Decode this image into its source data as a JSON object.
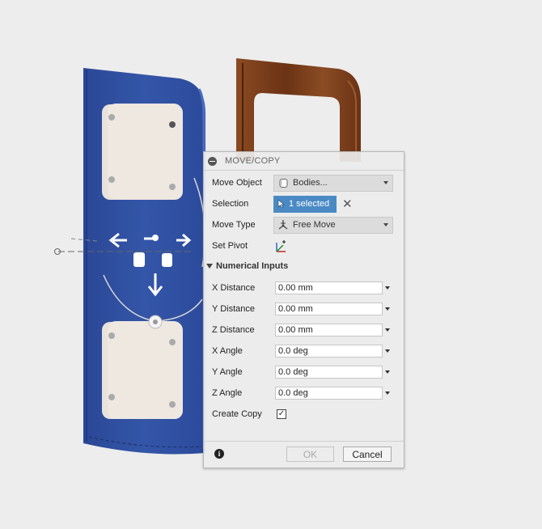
{
  "panel": {
    "title": "MOVE/COPY",
    "move_object": {
      "label": "Move Object",
      "value": "Bodies...",
      "icon": "body-icon"
    },
    "selection": {
      "label": "Selection",
      "value": "1 selected",
      "icon": "cursor-icon",
      "clear_glyph": "✕"
    },
    "move_type": {
      "label": "Move Type",
      "value": "Free Move",
      "icon": "free-move-icon"
    },
    "set_pivot": {
      "label": "Set Pivot",
      "icon": "pivot-axes-icon"
    },
    "numerical": {
      "section_label": "Numerical Inputs",
      "fields": [
        {
          "label": "X Distance",
          "value": "0.00 mm"
        },
        {
          "label": "Y Distance",
          "value": "0.00 mm"
        },
        {
          "label": "Z Distance",
          "value": "0.00 mm"
        },
        {
          "label": "X Angle",
          "value": "0.0 deg"
        },
        {
          "label": "Y Angle",
          "value": "0.0 deg"
        },
        {
          "label": "Z Angle",
          "value": "0.0 deg"
        }
      ]
    },
    "create_copy": {
      "label": "Create Copy",
      "checked": true,
      "check_glyph": "✓"
    },
    "footer": {
      "info_glyph": "i",
      "ok_label": "OK",
      "cancel_label": "Cancel"
    }
  },
  "colors": {
    "blue_body": "#2f4e9e",
    "wood_body": "#7a3d1c",
    "selection_blue": "#4a8ac4",
    "window_cream": "#efe8e1"
  }
}
